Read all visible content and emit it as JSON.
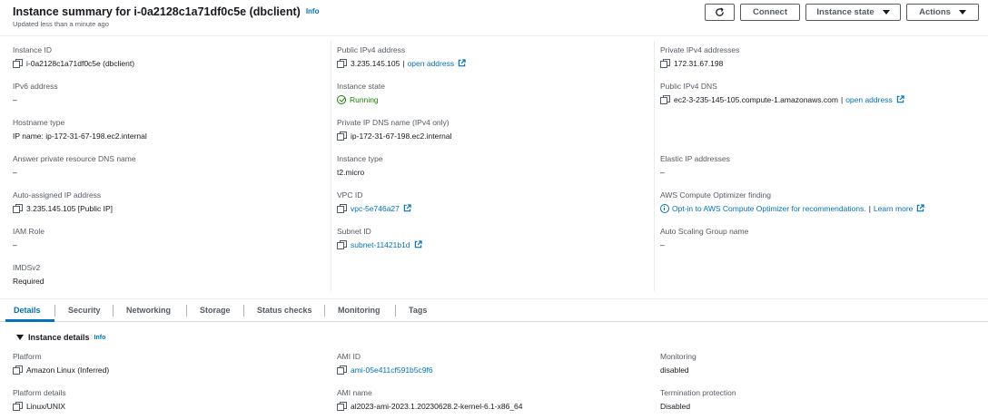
{
  "header": {
    "title": "Instance summary for i-0a2128c1a71df0c5e (dbclient)",
    "info": "Info",
    "subtitle": "Updated less than a minute ago",
    "refresh_icon": "refresh-icon",
    "connect": "Connect",
    "instance_state": "Instance state",
    "actions": "Actions"
  },
  "summary": {
    "instance_id": {
      "label": "Instance ID",
      "value": "i-0a2128c1a71df0c5e (dbclient)"
    },
    "public_ipv4": {
      "label": "Public IPv4 address",
      "value": "3.235.145.105",
      "sep": "|",
      "link": "open address"
    },
    "private_ipv4": {
      "label": "Private IPv4 addresses",
      "value": "172.31.67.198"
    },
    "ipv6": {
      "label": "IPv6 address",
      "value": "–"
    },
    "instance_state": {
      "label": "Instance state",
      "value": "Running"
    },
    "public_dns": {
      "label": "Public IPv4 DNS",
      "value": "ec2-3-235-145-105.compute-1.amazonaws.com",
      "sep": "|",
      "link": "open address"
    },
    "hostname_type": {
      "label": "Hostname type",
      "value": "IP name: ip-172-31-67-198.ec2.internal"
    },
    "private_dns": {
      "label": "Private IP DNS name (IPv4 only)",
      "value": "ip-172-31-67-198.ec2.internal"
    },
    "answer_dns": {
      "label": "Answer private resource DNS name",
      "value": "–"
    },
    "instance_type": {
      "label": "Instance type",
      "value": "t2.micro"
    },
    "elastic_ip": {
      "label": "Elastic IP addresses",
      "value": "–"
    },
    "auto_ip": {
      "label": "Auto-assigned IP address",
      "value": "3.235.145.105 [Public IP]"
    },
    "vpc_id": {
      "label": "VPC ID",
      "value": "vpc-5e746a27"
    },
    "optimizer": {
      "label": "AWS Compute Optimizer finding",
      "value": "Opt-in to AWS Compute Optimizer for recommendations.",
      "sep": "|",
      "link": "Learn more"
    },
    "iam_role": {
      "label": "IAM Role",
      "value": "–"
    },
    "subnet_id": {
      "label": "Subnet ID",
      "value": "subnet-11421b1d"
    },
    "asg_name": {
      "label": "Auto Scaling Group name",
      "value": "–"
    },
    "imdsv2": {
      "label": "IMDSv2",
      "value": "Required"
    }
  },
  "tabs": [
    "Details",
    "Security",
    "Networking",
    "Storage",
    "Status checks",
    "Monitoring",
    "Tags"
  ],
  "details": {
    "section_title": "Instance details",
    "info": "Info",
    "platform": {
      "label": "Platform",
      "value": "Amazon Linux (Inferred)"
    },
    "ami_id": {
      "label": "AMI ID",
      "value": "ami-05e411cf591b5c9f6"
    },
    "monitoring": {
      "label": "Monitoring",
      "value": "disabled"
    },
    "platform_details": {
      "label": "Platform details",
      "value": "Linux/UNIX"
    },
    "ami_name": {
      "label": "AMI name",
      "value": "al2023-ami-2023.1.20230628.2-kernel-6.1-x86_64"
    },
    "termination": {
      "label": "Termination protection",
      "value": "Disabled"
    }
  },
  "colors": {
    "link": "#0073bb",
    "success": "#1d8102",
    "text": "#16191f",
    "label": "#545b64"
  }
}
